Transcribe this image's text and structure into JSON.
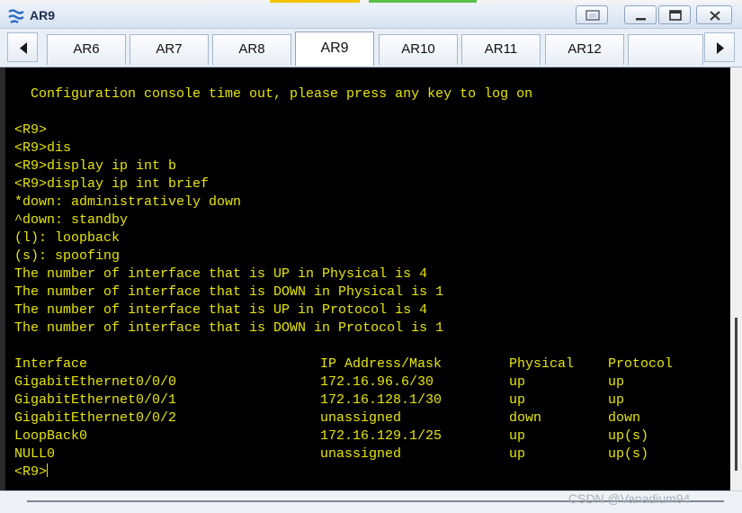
{
  "window": {
    "title": "AR9"
  },
  "tabs": [
    {
      "label": "AR6"
    },
    {
      "label": "AR7"
    },
    {
      "label": "AR8"
    },
    {
      "label": "AR9",
      "active": true
    },
    {
      "label": "AR10"
    },
    {
      "label": "AR11"
    },
    {
      "label": "AR12"
    }
  ],
  "console": {
    "timeout_message": "  Configuration console time out, please press any key to log on",
    "lines": [
      "<R9>",
      "<R9>dis",
      "<R9>display ip int b",
      "<R9>display ip int brief",
      "*down: administratively down",
      "^down: standby",
      "(l): loopback",
      "(s): spoofing",
      "The number of interface that is UP in Physical is 4",
      "The number of interface that is DOWN in Physical is 1",
      "The number of interface that is UP in Protocol is 4",
      "The number of interface that is DOWN in Protocol is 1"
    ],
    "table": {
      "headers": [
        "Interface",
        "IP Address/Mask",
        "Physical",
        "Protocol"
      ],
      "rows": [
        [
          "GigabitEthernet0/0/0",
          "172.16.96.6/30",
          "up",
          "up"
        ],
        [
          "GigabitEthernet0/0/1",
          "172.16.128.1/30",
          "up",
          "up"
        ],
        [
          "GigabitEthernet0/0/2",
          "unassigned",
          "down",
          "down"
        ],
        [
          "LoopBack0",
          "172.16.129.1/25",
          "up",
          "up(s)"
        ],
        [
          "NULL0",
          "unassigned",
          "up",
          "up(s)"
        ]
      ]
    },
    "prompt": "<R9>"
  },
  "watermark": "CSDN @Vanadium94",
  "colors": {
    "terminal_bg": "#000000",
    "terminal_text": "#e8e600"
  }
}
